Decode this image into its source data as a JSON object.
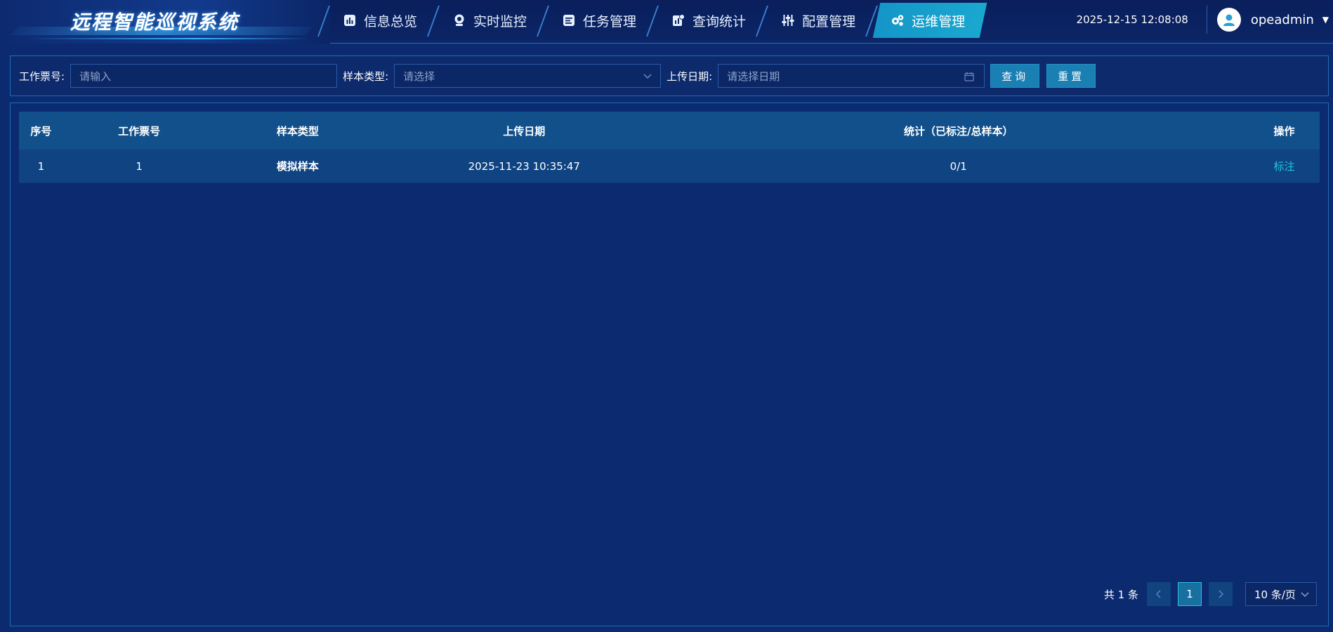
{
  "app": {
    "title": "远程智能巡视系统"
  },
  "nav": [
    {
      "label": "信息总览",
      "icon": "bar-chart-icon",
      "active": false
    },
    {
      "label": "实时监控",
      "icon": "webcam-icon",
      "active": false
    },
    {
      "label": "任务管理",
      "icon": "task-list-icon",
      "active": false
    },
    {
      "label": "查询统计",
      "icon": "stats-icon",
      "active": false
    },
    {
      "label": "配置管理",
      "icon": "sliders-icon",
      "active": false
    },
    {
      "label": "运维管理",
      "icon": "gears-icon",
      "active": true
    }
  ],
  "header": {
    "datetime": "2025-12-15 12:08:08",
    "username": "opeadmin"
  },
  "filters": {
    "ticket_label": "工作票号:",
    "ticket_placeholder": "请输入",
    "type_label": "样本类型:",
    "type_placeholder": "请选择",
    "date_label": "上传日期:",
    "date_placeholder": "请选择日期",
    "query_button": "查询",
    "reset_button": "重置"
  },
  "table": {
    "columns": [
      "序号",
      "工作票号",
      "样本类型",
      "上传日期",
      "统计（已标注/总样本）",
      "操作"
    ],
    "rows": [
      {
        "index": "1",
        "ticket": "1",
        "type": "模拟样本",
        "date": "2025-11-23 10:35:47",
        "stats": "0/1",
        "action": "标注"
      }
    ]
  },
  "pagination": {
    "total": "共 1 条",
    "current_page": "1",
    "page_size": "10 条/页"
  },
  "colors": {
    "background": "#0b2a6f",
    "accent": "#1aa8cf",
    "link": "#1ec8e6"
  }
}
